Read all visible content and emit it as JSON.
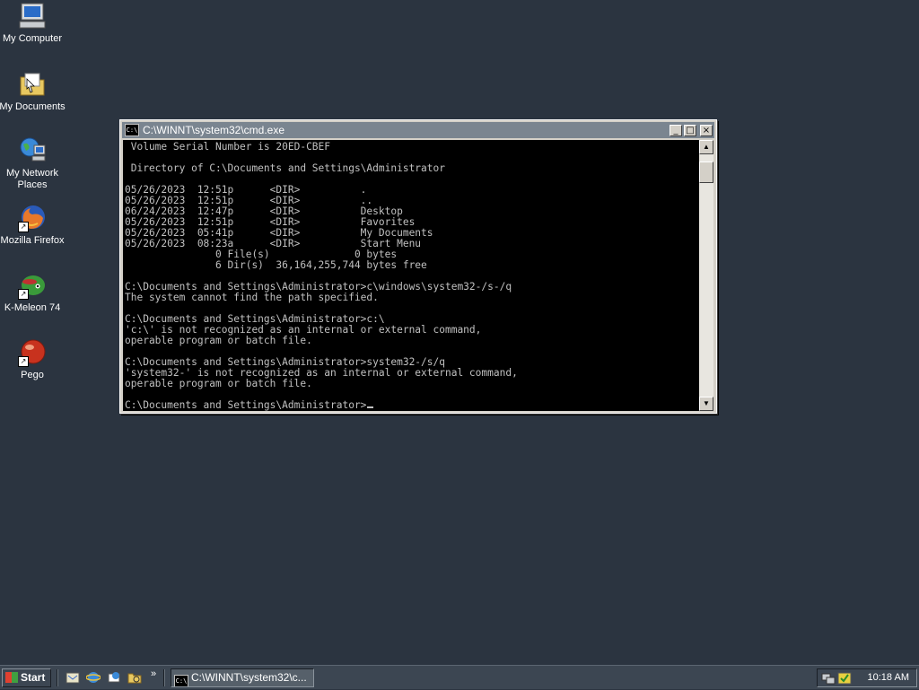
{
  "desktop": {
    "icons": [
      {
        "label": "My Computer",
        "icon": "my-computer-icon"
      },
      {
        "label": "My Documents",
        "icon": "my-documents-icon"
      },
      {
        "label": "My Network Places",
        "icon": "network-places-icon"
      },
      {
        "label": "Mozilla Firefox",
        "icon": "firefox-icon"
      },
      {
        "label": "K-Meleon 74",
        "icon": "k-meleon-icon"
      },
      {
        "label": "Pego",
        "icon": "pego-icon"
      }
    ]
  },
  "window": {
    "title": "C:\\WINNT\\system32\\cmd.exe",
    "icon_text": "C:\\",
    "buttons": {
      "minimize": "_",
      "maximize": "□",
      "close": "×"
    },
    "console_lines": [
      " Volume Serial Number is 20ED-CBEF",
      "",
      " Directory of C:\\Documents and Settings\\Administrator",
      "",
      "05/26/2023  12:51p      <DIR>          .",
      "05/26/2023  12:51p      <DIR>          ..",
      "06/24/2023  12:47p      <DIR>          Desktop",
      "05/26/2023  12:51p      <DIR>          Favorites",
      "05/26/2023  05:41p      <DIR>          My Documents",
      "05/26/2023  08:23a      <DIR>          Start Menu",
      "               0 File(s)              0 bytes",
      "               6 Dir(s)  36,164,255,744 bytes free",
      "",
      "C:\\Documents and Settings\\Administrator>c\\windows\\system32-/s-/q",
      "The system cannot find the path specified.",
      "",
      "C:\\Documents and Settings\\Administrator>c:\\",
      "'c:\\' is not recognized as an internal or external command,",
      "operable program or batch file.",
      "",
      "C:\\Documents and Settings\\Administrator>system32-/s/q",
      "'system32-' is not recognized as an internal or external command,",
      "operable program or batch file.",
      "",
      "C:\\Documents and Settings\\Administrator>"
    ],
    "scrollbar": {
      "up": "▲",
      "down": "▼"
    }
  },
  "taskbar": {
    "start_label": "Start",
    "quicklaunch": [
      "show-desktop-icon",
      "internet-explorer-icon",
      "outlook-express-icon",
      "explorer-icon"
    ],
    "chevron": "»",
    "task_button": "C:\\WINNT\\system32\\c...",
    "clock": "10:18 AM"
  }
}
